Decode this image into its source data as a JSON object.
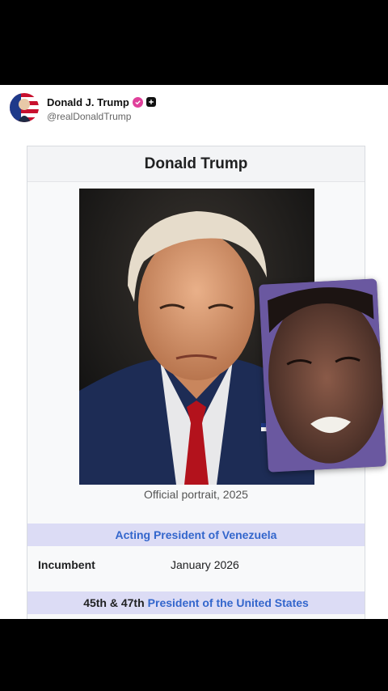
{
  "post": {
    "display_name": "Donald J. Trump",
    "handle": "@realDonaldTrump"
  },
  "infobox": {
    "title": "Donald Trump",
    "caption": "Official portrait, 2025",
    "section1": {
      "link": "Acting President of Venezuela"
    },
    "row": {
      "label": "Incumbent",
      "value": "January 2026"
    },
    "section2": {
      "prefix": "45th & 47th",
      "link": "President of the United States"
    }
  },
  "colors": {
    "section_bg": "#dcdcf5",
    "link": "#3366cc",
    "verified": "#e0409b"
  },
  "icons": [
    "flag-avatar",
    "verified-badge-icon",
    "plus-badge-icon"
  ]
}
